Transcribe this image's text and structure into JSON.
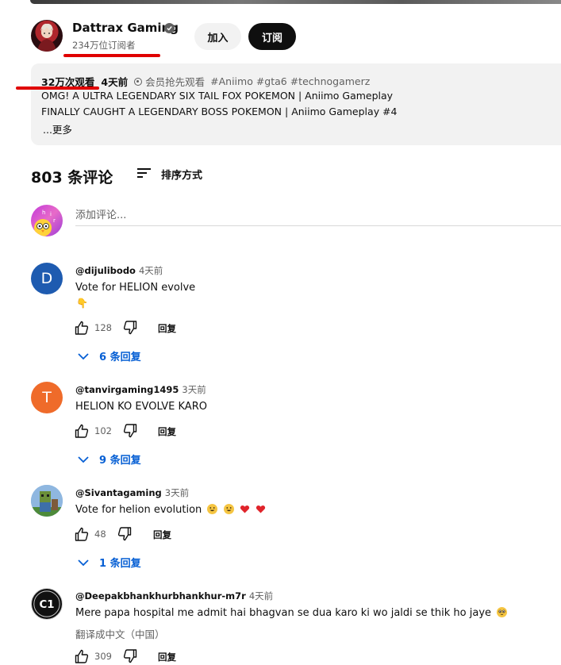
{
  "channel": {
    "name": "Dattrax Gaming",
    "subscribers": "234万位订阅者",
    "join_label": "加入",
    "subscribe_label": "订阅",
    "verified_icon": "verified-check-icon"
  },
  "description": {
    "views": "32万次观看",
    "posted": "4天前",
    "members_first": "会员抢先观看",
    "hashtags": "#Aniimo #gta6 #technogamerz",
    "line1": "OMG! A ULTRA LEGENDARY SIX TAIL FOX POKEMON | Aniimo Gameplay",
    "line2": "FINALLY CAUGHT A LEGENDARY BOSS POKEMON | Aniimo Gameplay #4",
    "more_label": "...更多"
  },
  "comments_header": {
    "count_label": "803 条评论",
    "sort_label": "排序方式"
  },
  "add_comment": {
    "placeholder": "添加评论..."
  },
  "comments": [
    {
      "author": "@dijulibodo",
      "time": "4天前",
      "avatar_letter": "D",
      "avatar_color": "#1e5bb0",
      "text": "Vote for HELION evolve",
      "emoji_line": "👇",
      "likes": "128",
      "reply_label": "回复",
      "replies_label": "6 条回复"
    },
    {
      "author": "@tanvirgaming1495",
      "time": "3天前",
      "avatar_letter": "T",
      "avatar_color": "#ef6b2a",
      "text": "HELION KO EVOLVE KARO",
      "likes": "102",
      "reply_label": "回复",
      "replies_label": "9 条回复"
    },
    {
      "author": "@Sivantagaming",
      "time": "3天前",
      "text": "Vote for helion evolution",
      "likes": "48",
      "reply_label": "回复",
      "replies_label": "1 条回复"
    },
    {
      "author": "@Deepakbhankhurbhankhur-m7r",
      "time": "4天前",
      "avatar_text": "C1",
      "text": "Mere papa hospital me admit hai bhagvan se dua karo ki wo jaldi se thik ho jaye",
      "translate_label": "翻译成中文（中国）",
      "likes": "309",
      "reply_label": "回复"
    }
  ],
  "colors": {
    "accent_blue": "#065fd4",
    "highlight_red": "#e00000",
    "muted_text": "#606060"
  }
}
